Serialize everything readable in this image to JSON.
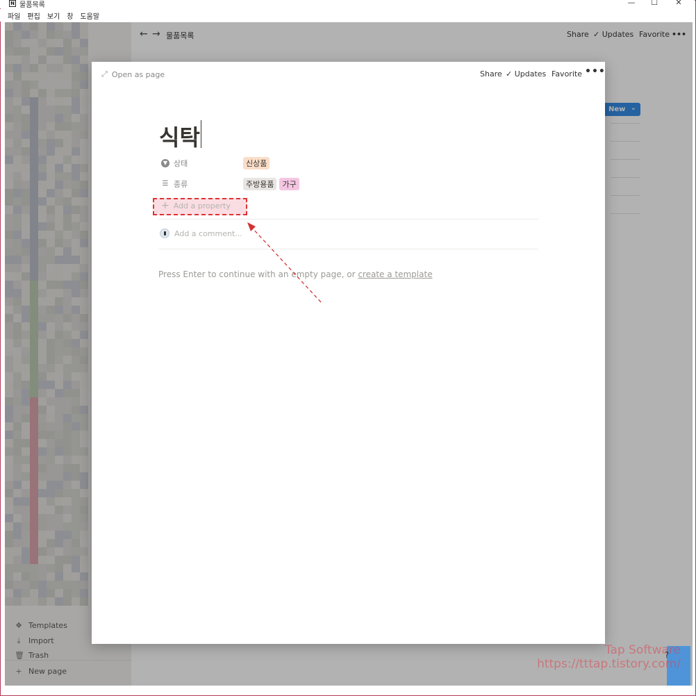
{
  "window": {
    "title": "물품목록",
    "app_icon": "N",
    "controls": {
      "minimize": "—",
      "maximize": "☐",
      "close": "✕"
    }
  },
  "menu": [
    "파일",
    "편집",
    "보기",
    "창",
    "도움말"
  ],
  "sidebar": {
    "bottom_items": [
      {
        "label": "Templates",
        "icon": "templates-icon"
      },
      {
        "label": "Import",
        "icon": "download-icon"
      },
      {
        "label": "Trash",
        "icon": "trash-icon"
      }
    ],
    "new_page": "New page"
  },
  "topbar": {
    "breadcrumb": "물품목록",
    "share": "Share",
    "updates": "Updates",
    "favorite": "Favorite",
    "more": "•••"
  },
  "database": {
    "new_button": "New",
    "new_dropdown": "⌄"
  },
  "modal": {
    "open_as_page": "Open as page",
    "share": "Share",
    "updates": "Updates",
    "favorite": "Favorite",
    "more": "•••",
    "title": "식탁",
    "properties": [
      {
        "name": "상태",
        "icon": "status-icon",
        "tags": [
          {
            "label": "신상품",
            "color": "#fadec9"
          }
        ]
      },
      {
        "name": "종류",
        "icon": "list-icon",
        "tags": [
          {
            "label": "주방용품",
            "color": "#e9e5e3"
          },
          {
            "label": "가구",
            "color": "#f4c6e2"
          }
        ]
      }
    ],
    "add_property": "Add a property",
    "add_comment": "Add a comment...",
    "hint_text": "Press Enter to continue with an empty page, or ",
    "hint_link": "create a template"
  },
  "watermark": {
    "line1": "Tap Software",
    "line2": "https://tttap.tistory.com/"
  },
  "help": "?",
  "colors": {
    "annotation_red": "#d33333",
    "accent_blue": "#2e8ae6"
  }
}
